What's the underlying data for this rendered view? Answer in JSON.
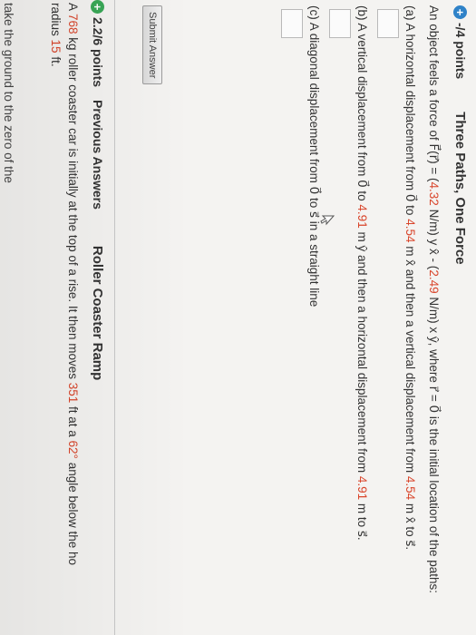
{
  "question1": {
    "points": "-/4 points",
    "title": "Three Paths, One Force",
    "intro": "An object feels a force of F(r) = (4.32 N/m) y x̂ - (2.49 N/m) x ŷ, where r = 0 is the initial location of the paths:",
    "intro_parts": {
      "a": "An object feels a force of F⃗(r⃗) = (",
      "b": "4.32",
      "c": " N/m) y x̂ - (",
      "d": "2.49",
      "e": " N/m) x ŷ, where r⃗ = 0⃗ is the initial location of the paths:"
    },
    "parts": [
      {
        "label": "(a) A horizontal displacement from 0⃗ to ",
        "v1": "4.54",
        "mid": " m x̂ and then a vertical displacement from ",
        "v2": "4.54",
        "end": " m x̂ to s⃗."
      },
      {
        "label": "(b) A vertical displacement from 0⃗ to ",
        "v1": "4.91",
        "mid": " m ŷ and then a horizontal displacement from ",
        "v2": "4.91",
        "end": " m to s⃗."
      },
      {
        "label": "(c) A diagonal displacement from 0⃗ to s⃗ in a straight line"
      }
    ],
    "submit_label": "Submit Answer"
  },
  "question2": {
    "points": "2.2/6 points",
    "previous_label": "Previous Answers",
    "title": "Roller Coaster Ramp",
    "text": {
      "a": "A ",
      "mass": "768",
      "b": " kg roller coaster car is initially at the top of a rise. It then moves ",
      "dist": "351",
      "c": " ft at a ",
      "angle": "62°",
      "d": " angle below the ho",
      "e": "radius ",
      "radius": "15",
      "f": " ft."
    },
    "cut_text": "take the ground to the zero of the"
  },
  "colors": {
    "accent_blue": "#2f82c8",
    "accent_green": "#3aa857",
    "value_red": "#d9452b"
  },
  "icons": [
    "plus-circle-icon",
    "cursor-icon"
  ]
}
